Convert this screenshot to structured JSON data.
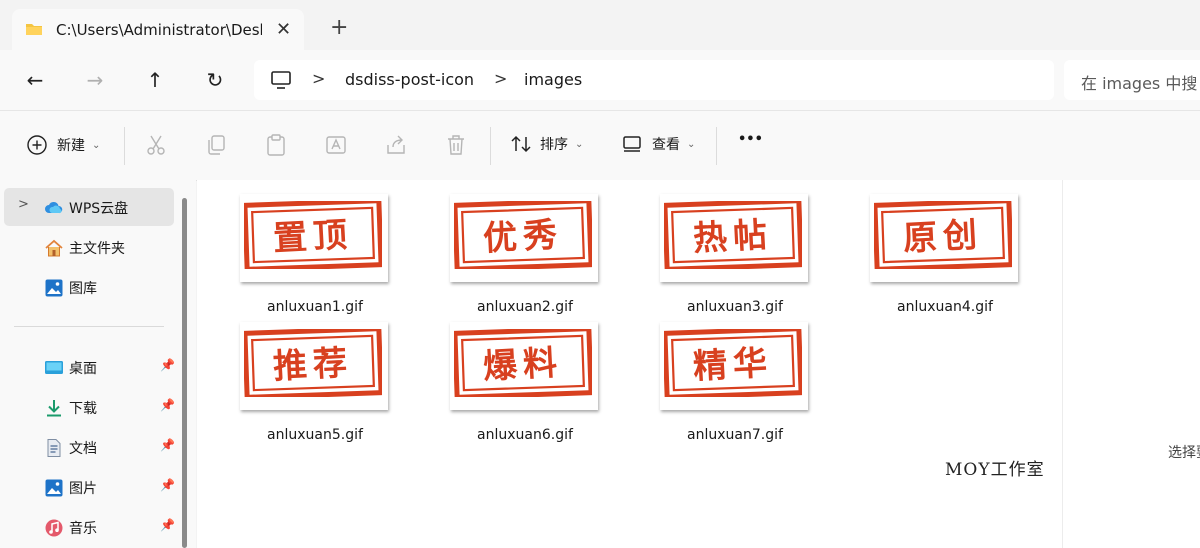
{
  "tab": {
    "title": "C:\\Users\\Administrator\\Desktop",
    "close": "✕",
    "new_tab": "+"
  },
  "nav": {
    "back": "←",
    "forward": "→",
    "up": "↑",
    "refresh": "↻"
  },
  "address": {
    "separator": ">",
    "crumbs": [
      "dsdiss-post-icon",
      "images"
    ]
  },
  "search": {
    "placeholder": "在 images 中搜"
  },
  "toolbar": {
    "new_label": "新建",
    "sort_label": "排序",
    "view_label": "查看",
    "more": "•••",
    "chevron": "⌄"
  },
  "sidebar": {
    "expand": ">",
    "pin": "📌",
    "items": [
      {
        "label": "WPS云盘",
        "icon": "cloud-icon"
      },
      {
        "label": "主文件夹",
        "icon": "home-icon"
      },
      {
        "label": "图库",
        "icon": "gallery-icon"
      },
      {
        "label": "桌面",
        "icon": "desktop-icon"
      },
      {
        "label": "下载",
        "icon": "download-icon"
      },
      {
        "label": "文档",
        "icon": "document-icon"
      },
      {
        "label": "图片",
        "icon": "pictures-icon"
      },
      {
        "label": "音乐",
        "icon": "music-icon"
      }
    ]
  },
  "files": [
    {
      "name": "anluxuan1.gif",
      "stamp": "置顶"
    },
    {
      "name": "anluxuan2.gif",
      "stamp": "优秀"
    },
    {
      "name": "anluxuan3.gif",
      "stamp": "热帖"
    },
    {
      "name": "anluxuan4.gif",
      "stamp": "原创"
    },
    {
      "name": "anluxuan5.gif",
      "stamp": "推荐"
    },
    {
      "name": "anluxuan6.gif",
      "stamp": "爆料"
    },
    {
      "name": "anluxuan7.gif",
      "stamp": "精华"
    }
  ],
  "watermark": "MOY工作室",
  "details": {
    "text": "选择要"
  },
  "colors": {
    "stamp_red": "#d8401f",
    "folder_yellow": "#f4c542",
    "accent_blue": "#1e73c8"
  }
}
